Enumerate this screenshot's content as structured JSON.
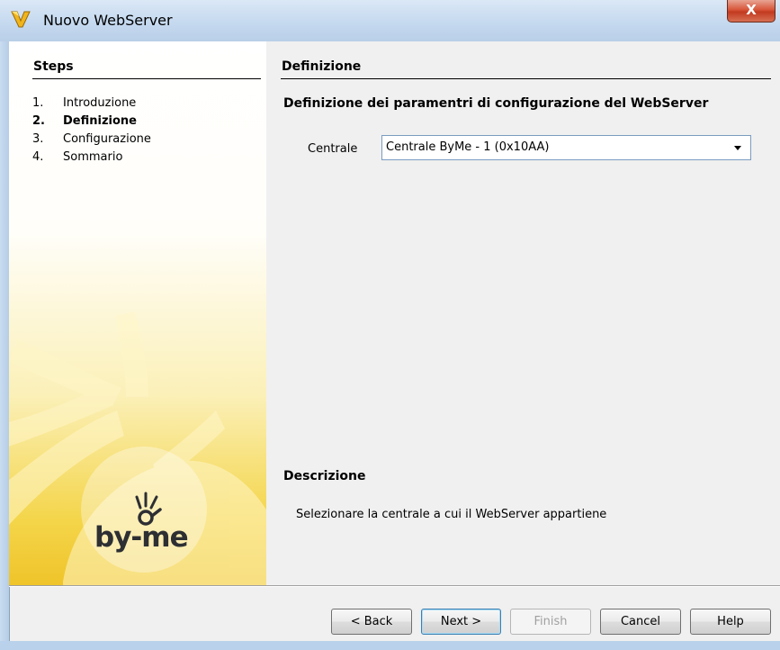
{
  "window": {
    "title": "Nuovo WebServer",
    "close_label": "X"
  },
  "sidebar": {
    "title": "Steps",
    "steps": [
      {
        "num": "1.",
        "label": "Introduzione"
      },
      {
        "num": "2.",
        "label": "Definizione"
      },
      {
        "num": "3.",
        "label": "Configurazione"
      },
      {
        "num": "4.",
        "label": "Sommario"
      }
    ],
    "current_step": 2,
    "logo_text": "by-me"
  },
  "main": {
    "title": "Definizione",
    "subheading": "Definizione dei paramentri di configurazione del WebServer",
    "field_label": "Centrale",
    "combo_value": "Centrale ByMe - 1 (0x10AA)",
    "description_title": "Descrizione",
    "description_text": "Selezionare la centrale a cui il WebServer appartiene"
  },
  "buttons": {
    "back": "< Back",
    "next": "Next >",
    "finish": "Finish",
    "cancel": "Cancel",
    "help": "Help"
  },
  "colors": {
    "title_bar": "#c5d9ef",
    "sidebar_gradient_bottom": "#efc42a",
    "close_button": "#c23a20"
  }
}
